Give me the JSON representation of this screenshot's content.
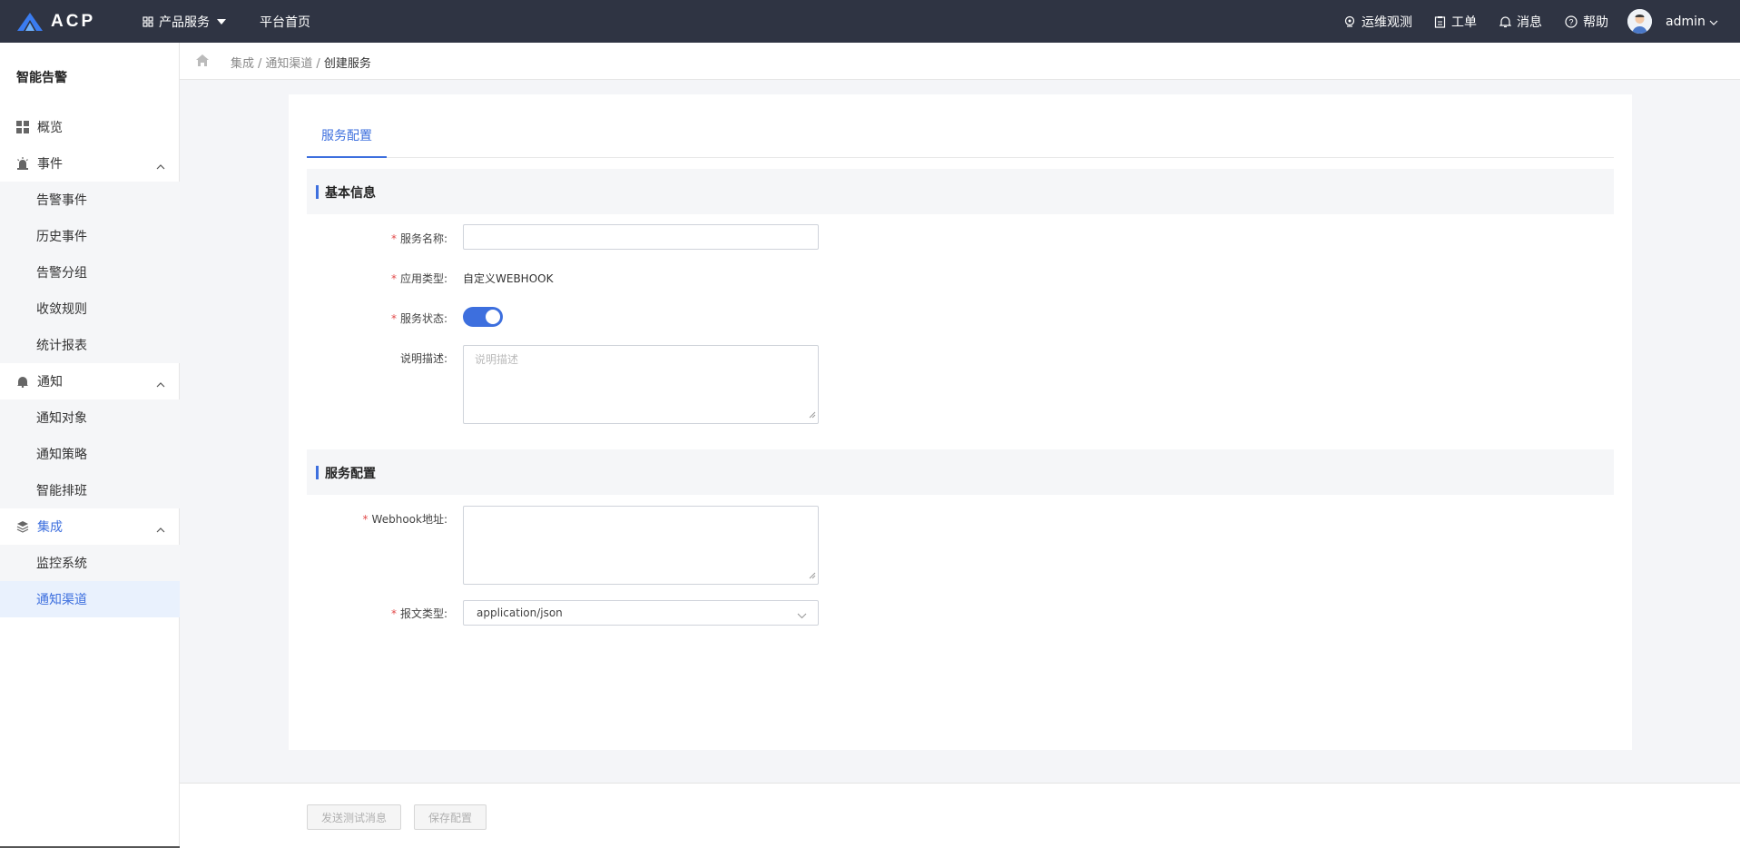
{
  "header": {
    "logo_text": "ACP",
    "menu_products": "产品服务",
    "menu_home": "平台首页",
    "ops": "运维观测",
    "tickets": "工单",
    "messages": "消息",
    "help": "帮助",
    "user": "admin"
  },
  "sidebar": {
    "title": "智能告警",
    "overview": "概览",
    "events": {
      "label": "事件",
      "items": [
        "告警事件",
        "历史事件",
        "告警分组",
        "收敛规则",
        "统计报表"
      ]
    },
    "notify": {
      "label": "通知",
      "items": [
        "通知对象",
        "通知策略",
        "智能排班"
      ]
    },
    "integration": {
      "label": "集成",
      "items": [
        "监控系统",
        "通知渠道"
      ]
    }
  },
  "breadcrumb": {
    "items": [
      "集成",
      "通知渠道",
      "创建服务"
    ]
  },
  "tabs": [
    "服务配置"
  ],
  "basic": {
    "title": "基本信息",
    "name_label": "服务名称:",
    "name_value": "",
    "type_label": "应用类型:",
    "type_value": "自定义WEBHOOK",
    "status_label": "服务状态:",
    "status_on": true,
    "desc_label": "说明描述:",
    "desc_placeholder": "说明描述"
  },
  "config": {
    "title": "服务配置",
    "webhook_label": "Webhook地址:",
    "webhook_value": "",
    "msgtype_label": "报文类型:",
    "msgtype_value": "application/json"
  },
  "footer": {
    "send_test": "发送测试消息",
    "save": "保存配置"
  },
  "colors": {
    "accent": "#3d6fde",
    "topbar": "#2f3443",
    "required": "#e24b4b"
  }
}
